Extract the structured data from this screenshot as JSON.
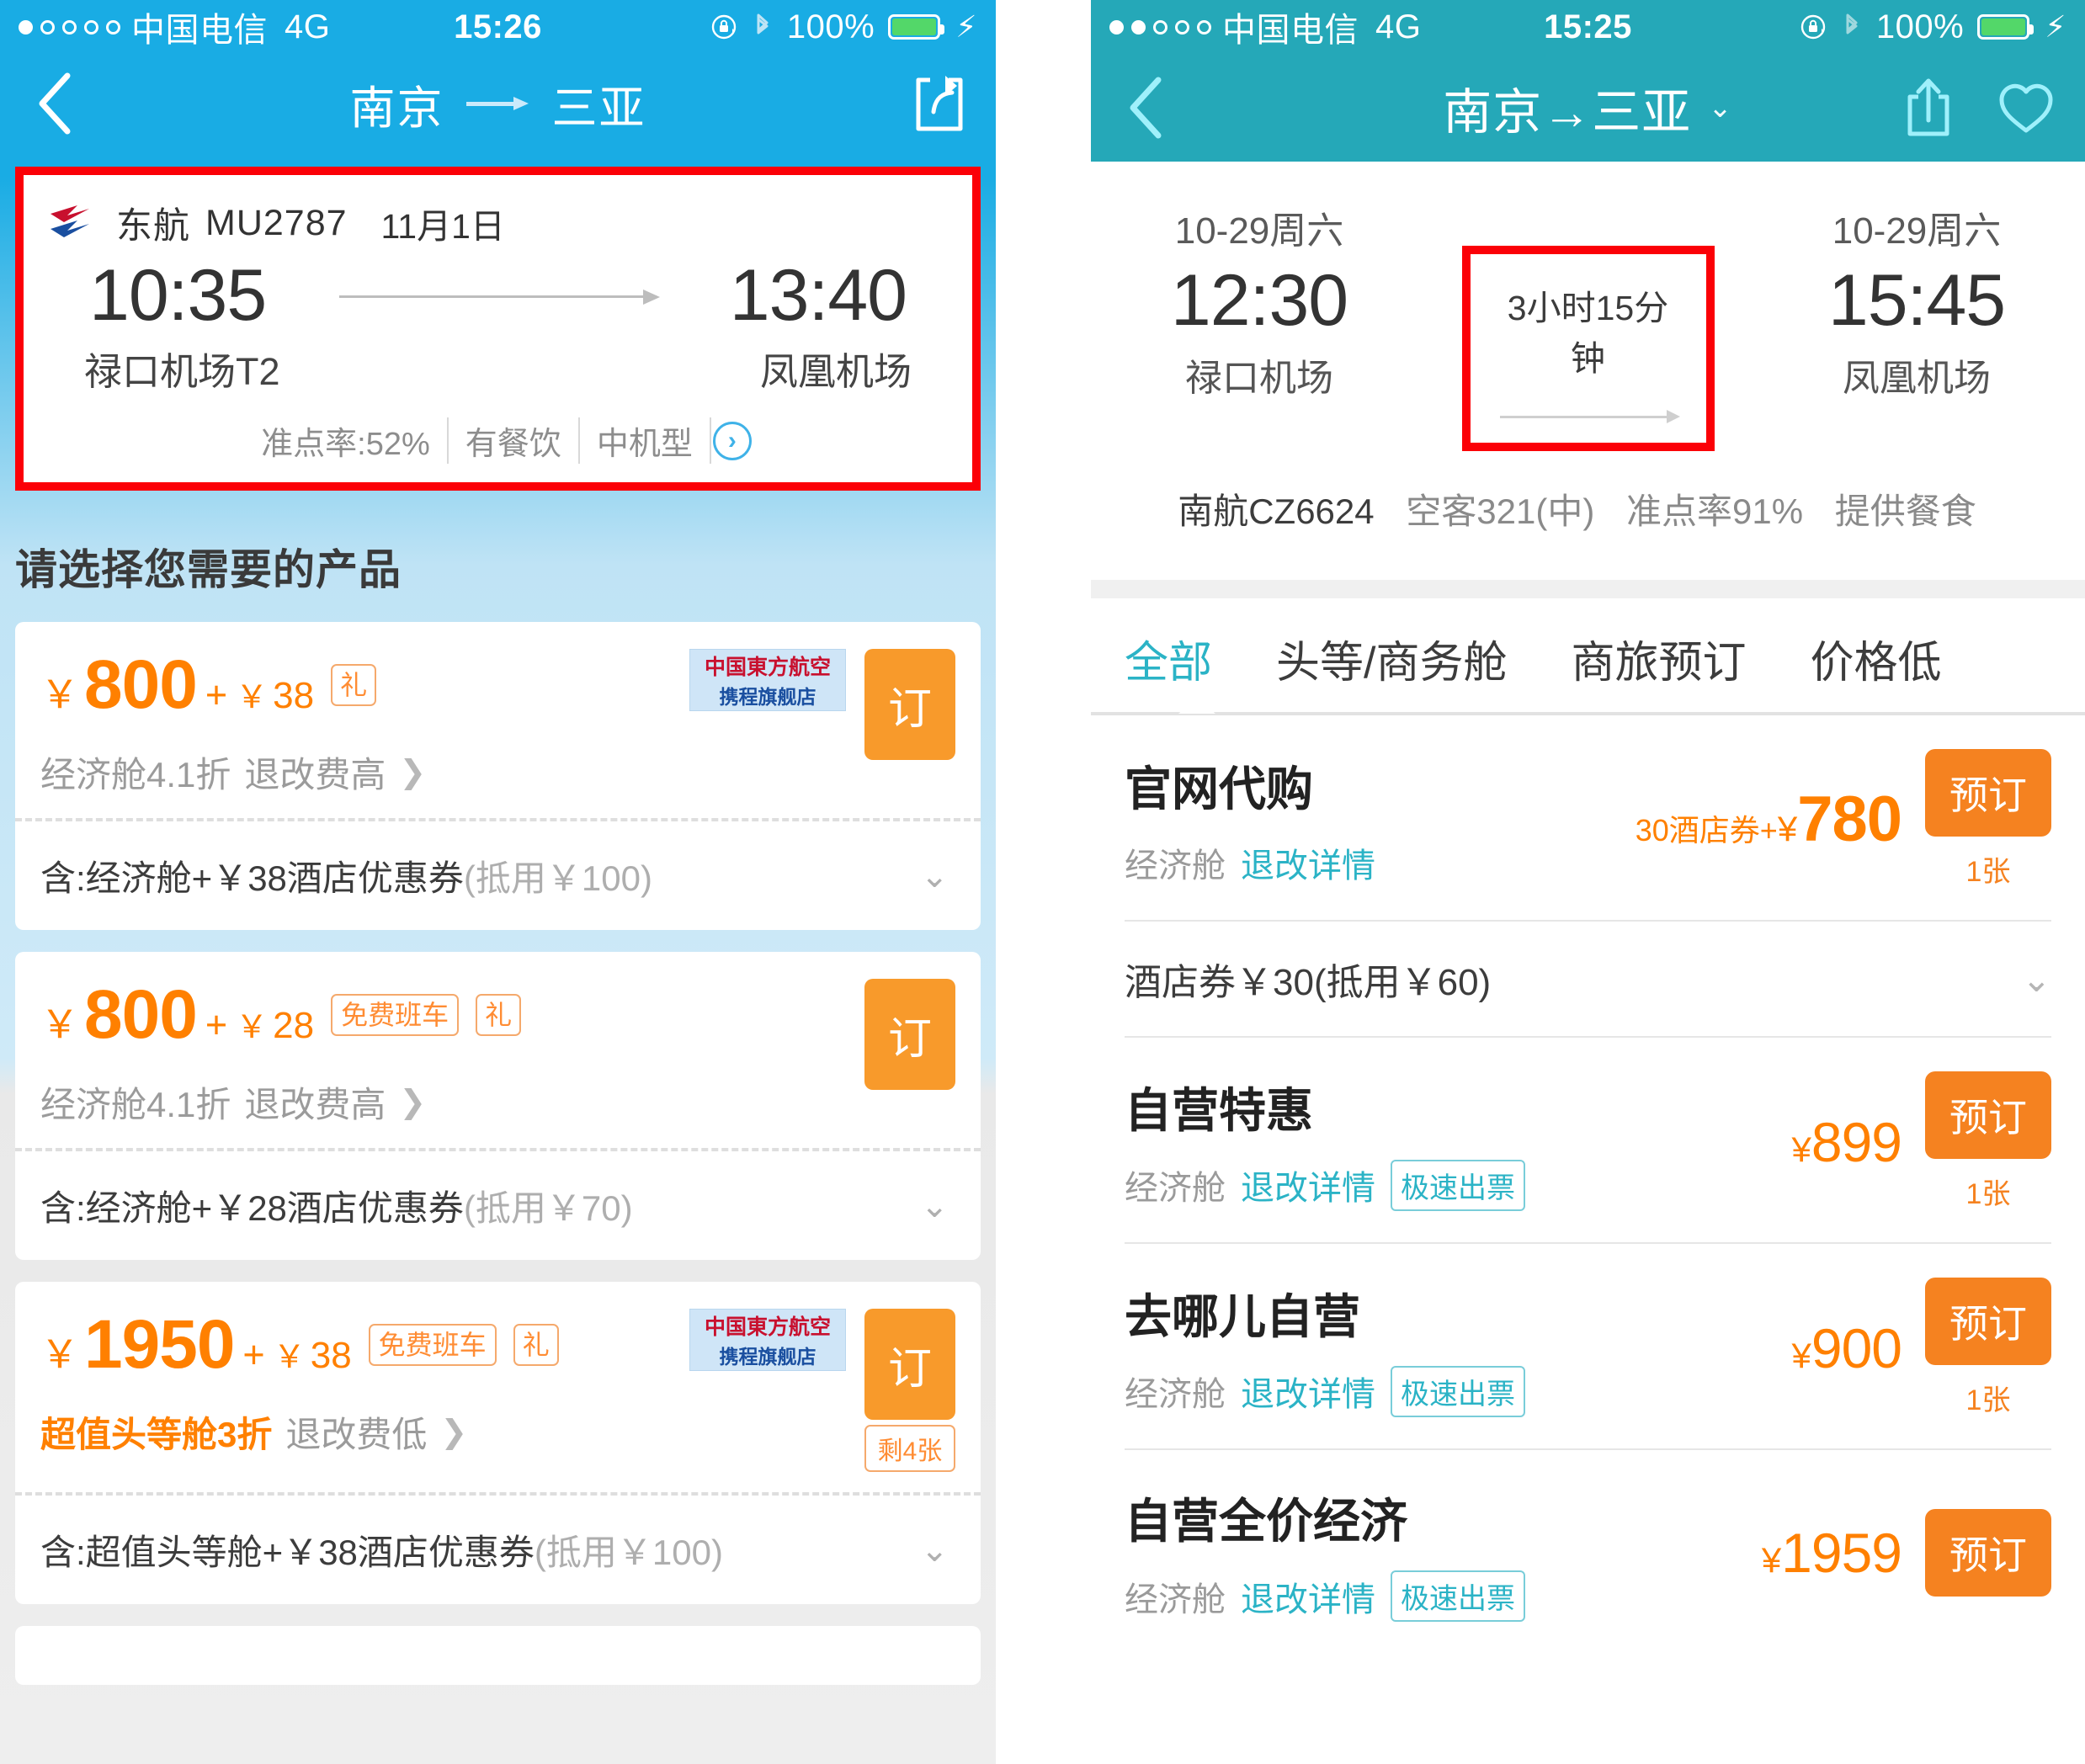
{
  "left": {
    "status": {
      "carrier": "中国电信",
      "network": "4G",
      "time": "15:26",
      "battery_pct": "100%",
      "signal_dots": 5,
      "signal_filled": 1
    },
    "nav": {
      "origin": "南京",
      "destination": "三亚"
    },
    "flight": {
      "airline": "东航",
      "flight_no": "MU2787",
      "date": "11月1日",
      "dep_time": "10:35",
      "arr_time": "13:40",
      "dep_airport": "禄口机场T2",
      "arr_airport": "凤凰机场",
      "ontime": "准点率:52%",
      "meal": "有餐饮",
      "aircraft": "中机型"
    },
    "section_title": "请选择您需要的产品",
    "products": [
      {
        "price": "800",
        "extra": "38",
        "tags": [
          "礼"
        ],
        "has_airline_badge": true,
        "desc": "经济舱4.1折",
        "refund": "退改费高",
        "button": "订",
        "stock": "",
        "include_prefix": "含:经济舱+￥38酒店优惠券",
        "include_suffix": "(抵用￥100)"
      },
      {
        "price": "800",
        "extra": "28",
        "tags": [
          "免费班车",
          "礼"
        ],
        "has_airline_badge": false,
        "desc": "经济舱4.1折",
        "refund": "退改费高",
        "button": "订",
        "stock": "",
        "include_prefix": "含:经济舱+￥28酒店优惠券",
        "include_suffix": "(抵用￥70)"
      },
      {
        "price": "1950",
        "extra": "38",
        "tags": [
          "免费班车",
          "礼"
        ],
        "has_airline_badge": true,
        "desc": "超值头等舱3折",
        "refund": "退改费低",
        "button": "订",
        "stock": "剩4张",
        "include_prefix": "含:超值头等舱+￥38酒店优惠券",
        "include_suffix": "(抵用￥100)"
      }
    ],
    "airline_badge": {
      "line1": "中国東方航空",
      "line2": "携程旗舰店"
    }
  },
  "right": {
    "status": {
      "carrier": "中国电信",
      "network": "4G",
      "time": "15:25",
      "battery_pct": "100%",
      "signal_dots": 5,
      "signal_filled": 2
    },
    "nav": {
      "title": "南京→三亚"
    },
    "flight": {
      "dep_date": "10-29周六",
      "dep_time": "12:30",
      "dep_airport": "禄口机场",
      "duration": "3小时15分钟",
      "arr_date": "10-29周六",
      "arr_time": "15:45",
      "arr_airport": "凤凰机场",
      "carrier_flight": "南航CZ6624",
      "aircraft": "空客321(中)",
      "ontime": "准点率91%",
      "meal": "提供餐食"
    },
    "tabs": [
      {
        "label": "全部",
        "active": true
      },
      {
        "label": "头等/商务舱",
        "active": false
      },
      {
        "label": "商旅预订",
        "active": false
      },
      {
        "label": "价格低",
        "active": false
      }
    ],
    "offers": [
      {
        "title": "官网代购",
        "cabin": "经济舱",
        "link": "退改详情",
        "fast_badge": "",
        "coupon_prefix": "30酒店券+",
        "price": "780",
        "button": "预订",
        "qty": "1张",
        "coupon_row": "酒店券￥30(抵用￥60)"
      },
      {
        "title": "自营特惠",
        "cabin": "经济舱",
        "link": "退改详情",
        "fast_badge": "极速出票",
        "coupon_prefix": "",
        "price": "899",
        "button": "预订",
        "qty": "1张",
        "coupon_row": ""
      },
      {
        "title": "去哪儿自营",
        "cabin": "经济舱",
        "link": "退改详情",
        "fast_badge": "极速出票",
        "coupon_prefix": "",
        "price": "900",
        "button": "预订",
        "qty": "1张",
        "coupon_row": ""
      },
      {
        "title": "自营全价经济",
        "cabin": "经济舱",
        "link": "退改详情",
        "fast_badge": "极速出票",
        "coupon_prefix": "",
        "price": "1959",
        "button": "预订",
        "qty": "",
        "coupon_row": ""
      }
    ]
  },
  "symbols": {
    "yen": "￥",
    "yen_small": "¥",
    "plus": "+",
    "chevron_right": "❯",
    "chevron_down": "⌄"
  }
}
